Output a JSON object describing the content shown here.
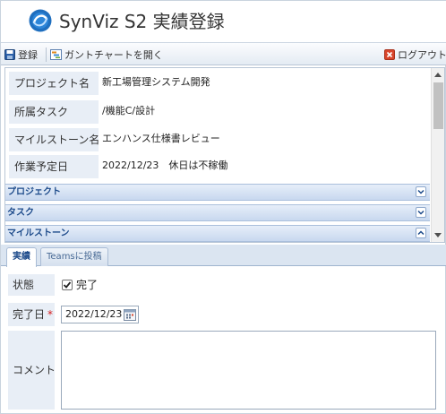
{
  "app": {
    "title": "SynViz S2 実績登録"
  },
  "toolbar": {
    "register_label": "登録",
    "gantt_label": "ガントチャートを開く",
    "logout_label": "ログアウト"
  },
  "info": {
    "rows": [
      {
        "label": "プロジェクト名",
        "value": "新工場管理システム開発"
      },
      {
        "label": "所属タスク",
        "value": "/機能C/設計"
      },
      {
        "label": "マイルストーン名",
        "value": "エンハンス仕様書レビュー"
      },
      {
        "label": "作業予定日",
        "value": "2022/12/23　休日は不稼働"
      }
    ]
  },
  "sections": {
    "project": "プロジェクト",
    "task": "タスク",
    "milestone": "マイルストーン"
  },
  "tabs": {
    "actual": "実績",
    "teams": "Teamsに投稿"
  },
  "form": {
    "status_label": "状態",
    "status_checkbox_label": "完了",
    "status_checked": true,
    "completion_date_label": "完了日",
    "required_mark": "*",
    "completion_date_value": "2022/12/23",
    "comment_label": "コメント",
    "comment_value": ""
  },
  "colors": {
    "brand": "#1f6fbf",
    "section_text": "#1c4a8a",
    "required": "#d61d1d",
    "label_bg": "#e8eef6"
  }
}
